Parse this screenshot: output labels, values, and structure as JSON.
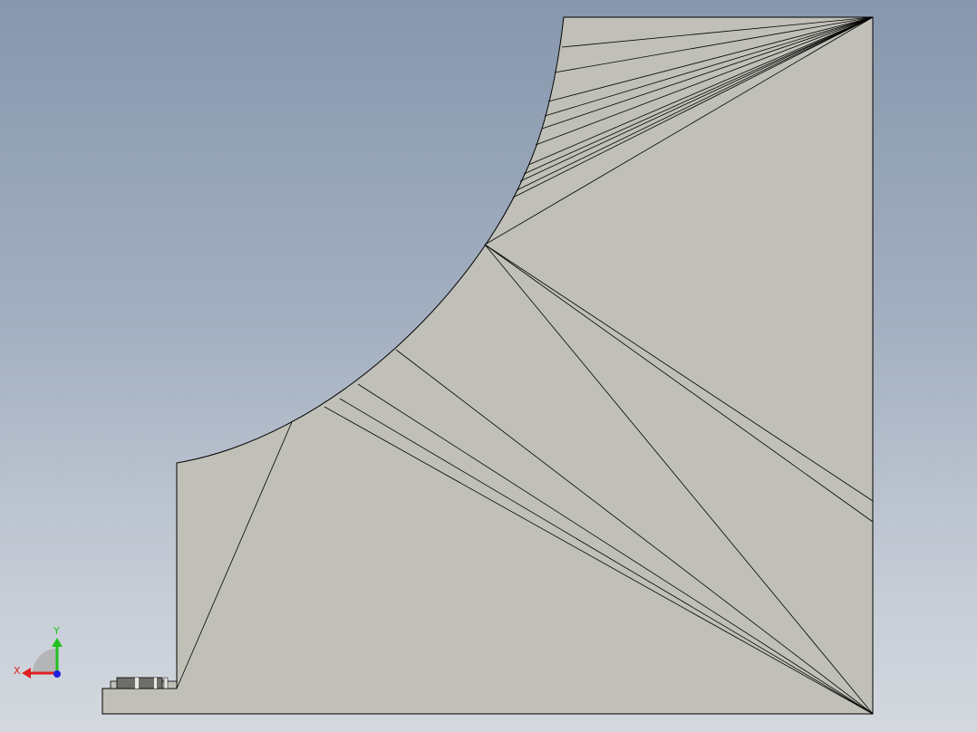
{
  "viewport": {
    "background_top": "#8797ad",
    "background_bottom": "#d4d9df",
    "part_face_color": "#c0c0b8",
    "edge_color": "#000000"
  },
  "triad": {
    "x_label": "X",
    "y_label": "Y",
    "x_color": "#e02020",
    "y_color": "#20c020",
    "z_color": "#2020e0"
  }
}
